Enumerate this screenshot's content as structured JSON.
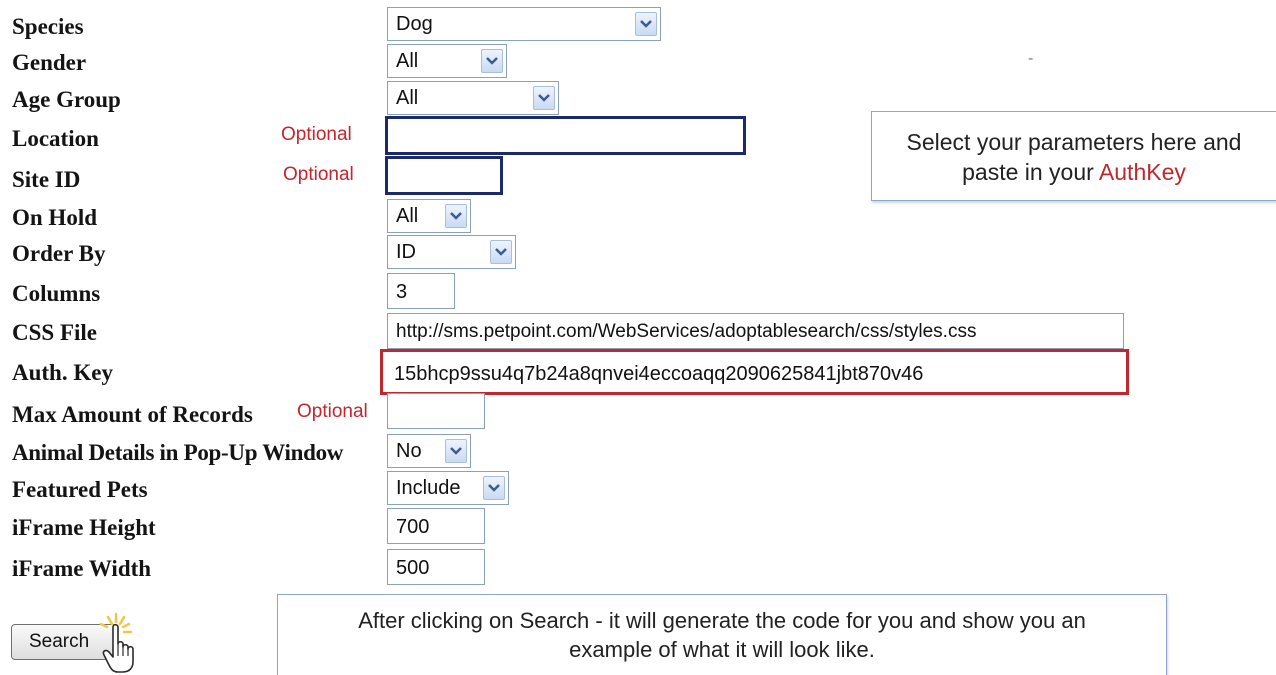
{
  "fields": {
    "species": {
      "label": "Species",
      "value": "Dog"
    },
    "gender": {
      "label": "Gender",
      "value": "All"
    },
    "age_group": {
      "label": "Age Group",
      "value": "All"
    },
    "location": {
      "label": "Location",
      "optional": "Optional",
      "value": ""
    },
    "site_id": {
      "label": "Site ID",
      "optional": "Optional",
      "value": ""
    },
    "on_hold": {
      "label": "On Hold",
      "value": "All"
    },
    "order_by": {
      "label": "Order By",
      "value": "ID"
    },
    "columns": {
      "label": "Columns",
      "value": "3"
    },
    "css_file": {
      "label": "CSS File",
      "value": "http://sms.petpoint.com/WebServices/adoptablesearch/css/styles.css"
    },
    "auth_key": {
      "label": "Auth. Key",
      "value": "15bhcp9ssu4q7b24a8qnvei4eccoaqq2090625841jbt870v46"
    },
    "max_records": {
      "label": "Max Amount of Records",
      "optional": "Optional",
      "value": ""
    },
    "popup": {
      "label": "Animal Details in Pop-Up Window",
      "value": "No"
    },
    "featured": {
      "label": "Featured Pets",
      "value": "Include"
    },
    "iframe_height": {
      "label": "iFrame Height",
      "value": "700"
    },
    "iframe_width": {
      "label": "iFrame Width",
      "value": "500"
    }
  },
  "search_button": {
    "label": "Search"
  },
  "callout_top": {
    "line1": "Select your parameters here and",
    "line2_prefix": "paste in your ",
    "line2_highlight": "AuthKey"
  },
  "callout_bottom": {
    "line1": "After clicking on Search - it will generate the code for you and show you an",
    "line2": "example of what it will look like."
  },
  "stray_mark": "-",
  "colors": {
    "optional_text": "#c3262d",
    "auth_key_highlight_border": "#c0282e",
    "focused_field_border": "#1b2a6b",
    "callout_border": "#8ea6c8"
  },
  "icons": {
    "dropdown": "chevron-down-icon",
    "cursor": "hand-pointer-icon"
  }
}
